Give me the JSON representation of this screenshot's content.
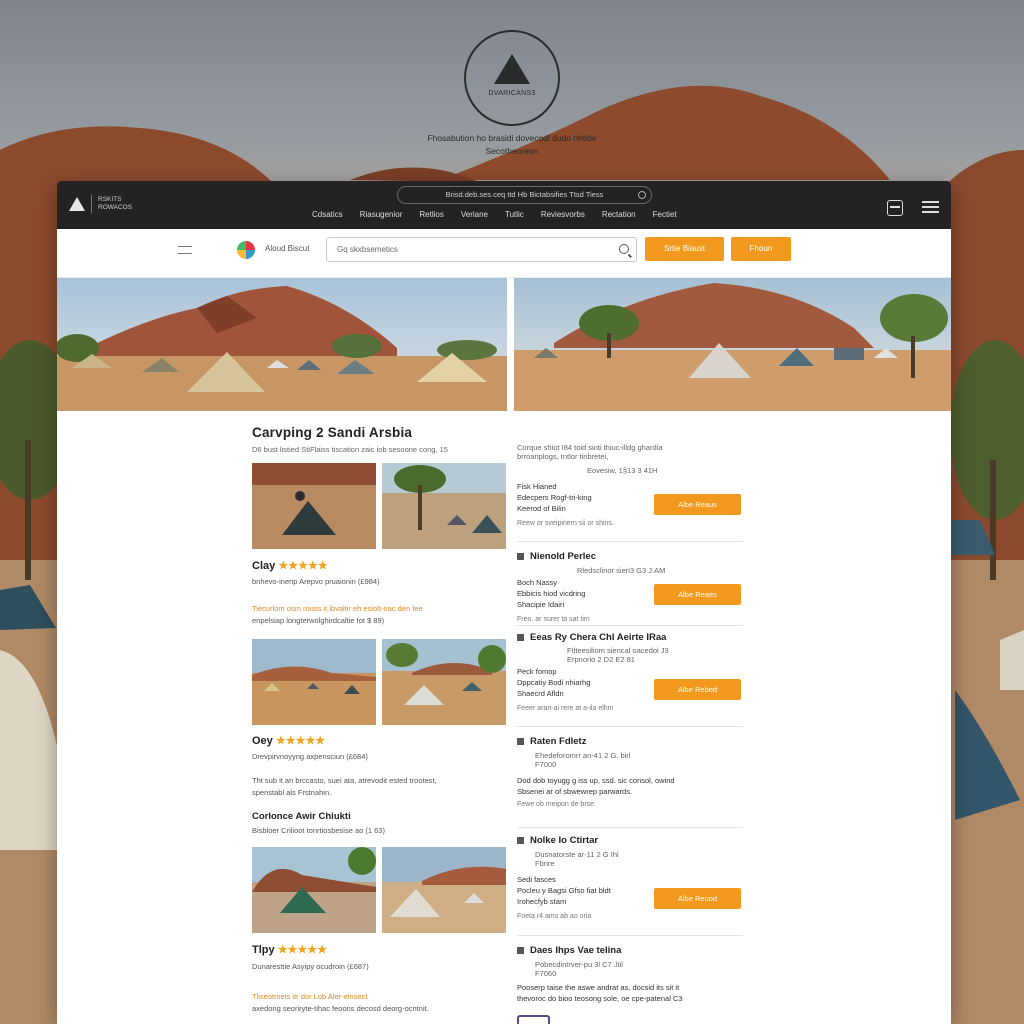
{
  "brand": {
    "badge_text": "DVARICANS3",
    "tagline_line1": "Fhosabution ho brasidi dovecodi dudo hhtide",
    "tagline_line2": "Secotheoreon"
  },
  "topbar": {
    "logo_line1": "RSKITS",
    "logo_line2": "ROWACOS",
    "url": "Brisd.deb.ses.ceq ttd Hb Bictabsifies Ttsd Tiess",
    "nav": [
      "Cdsatics",
      "Riasugenior",
      "Retlios",
      "Veriane",
      "Tutlic",
      "Reviesvorbs",
      "Rectation",
      "Fectiet"
    ]
  },
  "search": {
    "map_label": "Aloud Biscut",
    "placeholder": "Gq skxbsemetics",
    "button1": "Srtie Biaust",
    "button2": "Fhoun"
  },
  "listing": {
    "title": "Carvping 2 Sandi Arsbia",
    "subtitle": "D6 bust listied StiFlaiss tiscation zaic iob sesoone cong, 15",
    "groups": [
      {
        "name": "Clay",
        "stars": "★★★★★",
        "meta": "bnhevo-inenp Arepvo pruaionin (£984)",
        "desc1": "Tiecurlom osm rouss it ibvaltir eh esiolt-nac den fee",
        "desc2": "enpelsiap longterwolghirdcaltie fot $ 89)"
      },
      {
        "name": "Oey",
        "stars": "★★★★★",
        "meta": "Drevpirvnoyyng axpensciun (£684)",
        "desc1": "Tht sub it an brccasto, suei ata, atrevodit ested trootest,",
        "desc2": "spenstabl als Frstnahin."
      },
      {
        "name": "Corlonce Awir Chiukti",
        "stars": "",
        "meta": "Bisbloer Crilioot tonrtiosbesise ao (1 63)",
        "desc1": "",
        "desc2": ""
      },
      {
        "name": "Tlpy",
        "stars": "★★★★★",
        "meta": "Dunaresttie Asyipy ocudroin (£687)",
        "desc1": "Tliseotmets itr dor Lob Aler-elnsect",
        "desc2": "axedong seoriryte-tihac feoons decosd deorg-ocntnit."
      }
    ]
  },
  "right_column": {
    "intro_line1": "Corque shiot I84 toid sinti thiuc-illdg ghardia",
    "intro_line2": "brroanplogs, tntlor tinbretei,",
    "cards": [
      {
        "head": "",
        "meta1": "Eovesiw, 1§13 3 41H",
        "meta2": "",
        "feat1": "Fisk Hianed",
        "feat2": "Edecpers Rogf-tri-king",
        "feat3": "Keerod of Bilin",
        "foot": "Reew or sveipinern sii or shins.",
        "button": "Albe Reaus"
      },
      {
        "head": "Nienold Perlec",
        "meta1": "Rledsclinor sieri3 G3 J.AM",
        "meta2": "",
        "feat1": "Boch Nassy",
        "feat2": "Ebbicis hiod vicdring",
        "feat3": "Shacipie Idairi",
        "foot": "Freo. ar surer ta sat tim",
        "button": "Albe Reaes"
      },
      {
        "head": "Eeas Ry Chera Chl Aeirte IRaa",
        "meta1": "Ftlteesiliom siencal oacedoi J3",
        "meta2": "Erpnorio 2 D2 E2 81",
        "feat1": "Peck fomop",
        "feat2": "Dppcatiy Bodi nhiarhg",
        "feat3": "Shaecrd Afldn",
        "foot": "Feeer aran-ai rere at a-ila elhm",
        "button": "Albe Rebed"
      },
      {
        "head": "Raten Fdletz",
        "meta1": "Ehedeforomrr an-41 2 G. birl",
        "meta2": "F7000",
        "feat1": "Dod dob toyugg g iss up, ssd. sic consol, owind",
        "feat2": "Sbsenei ar of sbwewrep parwards.",
        "feat3": "",
        "foot": "Fewe ob meipon de brse.",
        "button": ""
      },
      {
        "head": "Nolke Io Ctirtar",
        "meta1": "Dusnatorste ar-11 2 G Ihl",
        "meta2": "Fbrire",
        "feat1": "Sedi fasces",
        "feat2": "Pocleu y Bagsi Gfso fiat bldt",
        "feat3": "Irohecfyb stam",
        "foot": "Foeta r4 ams ab ao oria",
        "button": "Albe Reuod"
      },
      {
        "head": "Daes Ihps Vae telina",
        "meta1": "Pobecdintrver-pu 3l C7 .ltil",
        "meta2": "F7060",
        "feat1": "Pooserp taise the aswe andrat as, docsid its sit it",
        "feat2": "thevoroc do bioo teosong sole, oe cpe-patenal C3",
        "feat3": "",
        "foot": "",
        "button": ""
      }
    ]
  }
}
